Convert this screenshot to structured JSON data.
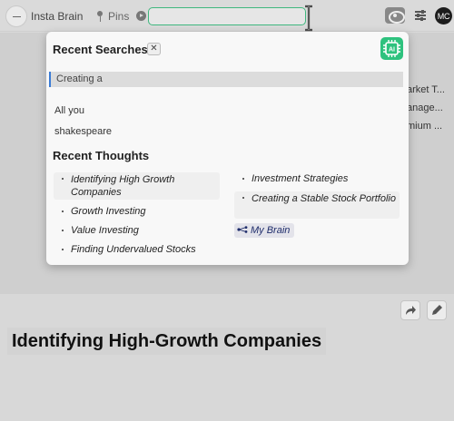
{
  "app": {
    "name": "Insta Brain",
    "pins_label": "Pins"
  },
  "search": {
    "value": "",
    "placeholder": ""
  },
  "user": {
    "initials": "MC"
  },
  "background": {
    "snippets": [
      "arket T...",
      "anage...",
      "mium ..."
    ],
    "page_title": "Identifying High-Growth Companies"
  },
  "dropdown": {
    "recent_searches_title": "Recent Searches",
    "clear_label": "✕",
    "ai_label": "AI",
    "recent_searches": [
      "Creating a",
      "All you",
      "shakespeare"
    ],
    "recent_thoughts_title": "Recent Thoughts",
    "thoughts_left": [
      "Identifying High  Growth Companies",
      "Growth Investing",
      "Value Investing",
      "Finding Undervalued Stocks"
    ],
    "thoughts_right": [
      "Investment Strategies",
      "Creating a Stable Stock Portfolio"
    ],
    "my_brain_label": "My Brain"
  },
  "icons": {
    "logo": "app-logo-icon",
    "pin": "pin-icon",
    "play": "play-icon",
    "eye": "eye-icon",
    "settings": "sliders-icon",
    "share": "share-icon",
    "edit": "pencil-icon",
    "brain": "brain-network-icon"
  },
  "colors": {
    "accent_green": "#2ec27e",
    "focus_green": "#3fb77e",
    "selection_blue": "#3a7bd5"
  }
}
